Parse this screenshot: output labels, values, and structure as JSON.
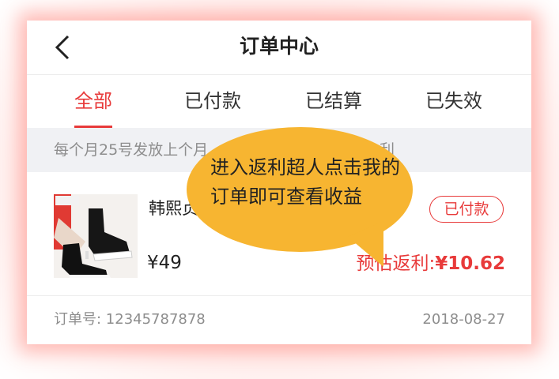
{
  "header": {
    "title": "订单中心",
    "back_icon": "chevron-left-icon"
  },
  "tabs": [
    {
      "label": "全部",
      "active": true
    },
    {
      "label": "已付款",
      "active": false
    },
    {
      "label": "已结算",
      "active": false
    },
    {
      "label": "已失效",
      "active": false
    }
  ],
  "notice": {
    "text": "每个月25号发放上个月",
    "text_end": "利"
  },
  "order": {
    "product_name": "韩熙贞",
    "price": "¥49",
    "status": "已付款",
    "rebate_label": "预估返利:",
    "rebate_value": "¥10.62",
    "order_no": "订单号: 12345787878",
    "date": "2018-08-27"
  },
  "tooltip": {
    "text": "进入返利超人点击我的订单即可查看收益"
  },
  "colors": {
    "accent": "#e83a3a",
    "bubble": "#f7b531",
    "notice_bg": "#f0f1f4"
  }
}
